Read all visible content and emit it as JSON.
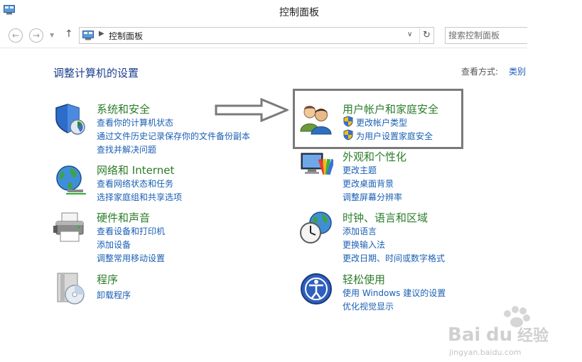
{
  "window": {
    "title": "控制面板"
  },
  "address": {
    "path": "控制面板",
    "search_placeholder": "搜索控制面板"
  },
  "header": {
    "page_title": "调整计算机的设置",
    "view_by_label": "查看方式:",
    "view_by_value": "类别"
  },
  "categories": [
    {
      "id": "system-security",
      "icon": "shield-icon",
      "title": "系统和安全",
      "links": [
        "查看你的计算机状态",
        "通过文件历史记录保存你的文件备份副本",
        "查找并解决问题"
      ]
    },
    {
      "id": "network-internet",
      "icon": "network-globe-icon",
      "title": "网络和 Internet",
      "links": [
        "查看网络状态和任务",
        "选择家庭组和共享选项"
      ]
    },
    {
      "id": "hardware-sound",
      "icon": "printer-icon",
      "title": "硬件和声音",
      "links": [
        "查看设备和打印机",
        "添加设备",
        "调整常用移动设置"
      ]
    },
    {
      "id": "programs",
      "icon": "program-disc-icon",
      "title": "程序",
      "links": [
        "卸载程序"
      ]
    },
    {
      "id": "user-accounts",
      "icon": "users-icon",
      "title": "用户帐户和家庭安全",
      "links": [
        "更改帐户类型",
        "为用户设置家庭安全"
      ]
    },
    {
      "id": "appearance",
      "icon": "monitor-colors-icon",
      "title": "外观和个性化",
      "links": [
        "更改主题",
        "更改桌面背景",
        "调整屏幕分辨率"
      ]
    },
    {
      "id": "clock-region",
      "icon": "clock-globe-icon",
      "title": "时钟、语言和区域",
      "links": [
        "添加语言",
        "更换输入法",
        "更改日期、时间或数字格式"
      ]
    },
    {
      "id": "ease-of-access",
      "icon": "ease-of-access-icon",
      "title": "轻松使用",
      "links": [
        "使用 Windows 建议的设置",
        "优化视觉显示"
      ]
    }
  ],
  "watermark": {
    "brand": "Bai du 经验",
    "url": "jingyan.baidu.com"
  },
  "colors": {
    "link": "#1a5fb4",
    "category_title": "#2b7d2b",
    "page_title": "#1a3e8c",
    "highlight_border": "#7a7a7a"
  }
}
